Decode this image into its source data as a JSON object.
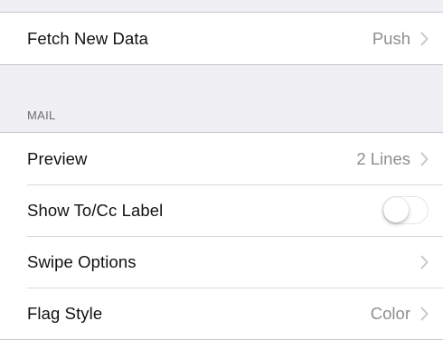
{
  "fetch_group": {
    "items": [
      {
        "label": "Fetch New Data",
        "value": "Push",
        "chevron_icon": "chevron-right-icon"
      }
    ]
  },
  "mail_section": {
    "header": "MAIL",
    "items": [
      {
        "label": "Preview",
        "value": "2 Lines",
        "chevron_icon": "chevron-right-icon"
      },
      {
        "label": "Show To/Cc Label",
        "toggle_on": false
      },
      {
        "label": "Swipe Options",
        "chevron_icon": "chevron-right-icon"
      },
      {
        "label": "Flag Style",
        "value": "Color",
        "chevron_icon": "chevron-right-icon"
      }
    ]
  },
  "colors": {
    "background": "#efeff4",
    "row_background": "#ffffff",
    "secondary_text": "#8e8e93",
    "chevron": "#c7c7cc",
    "toggle_border": "#e5e5ea"
  }
}
